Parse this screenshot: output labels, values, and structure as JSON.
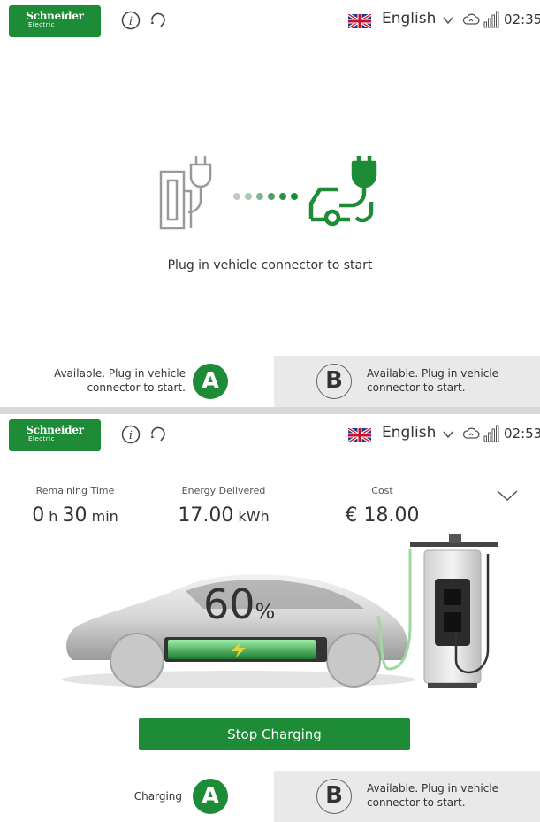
{
  "colors": {
    "brand_green": "#1e8c37",
    "inactive_gray": "#e9e9e9",
    "text": "#333333"
  },
  "logo": {
    "line1": "Schneider",
    "line2": "Electric"
  },
  "icons": [
    "info-icon",
    "support-icon",
    "uk-flag-icon",
    "chevron-down-icon",
    "cloud-connection-icon",
    "signal-icon",
    "expand-chevron-icon",
    "plug-icon",
    "car-icon",
    "lightning-icon"
  ],
  "screen1": {
    "header": {
      "language": "English",
      "time": "02:35"
    },
    "message": "Plug in vehicle connector to start",
    "connector_a": {
      "letter": "A",
      "status": "Available. Plug in vehicle connector to start."
    },
    "connector_b": {
      "letter": "B",
      "status": "Available. Plug in vehicle connector to start."
    }
  },
  "screen2": {
    "header": {
      "language": "English",
      "time": "02:53"
    },
    "remaining_time": {
      "label": "Remaining Time",
      "hours": "0",
      "h_unit": "h",
      "minutes": "30",
      "min_unit": "min"
    },
    "energy": {
      "label": "Energy Delivered",
      "value": "17.00",
      "unit": "kWh"
    },
    "cost": {
      "label": "Cost",
      "value": "€ 18.00"
    },
    "battery": {
      "percent": "60",
      "unit": "%",
      "level": 0.6
    },
    "stop_button": "Stop Charging",
    "connector_a": {
      "letter": "A",
      "status": "Charging"
    },
    "connector_b": {
      "letter": "B",
      "status": "Available. Plug in vehicle connector to start."
    }
  }
}
